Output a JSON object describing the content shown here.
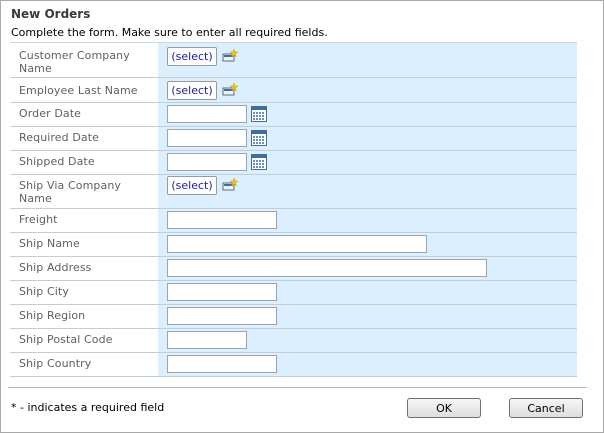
{
  "dialog": {
    "title": "New Orders",
    "description": "Complete the form. Make sure to enter all required fields."
  },
  "fields": {
    "customer_company": {
      "label": "Customer Company Name",
      "button": "(select)"
    },
    "employee_last": {
      "label": "Employee Last Name",
      "button": "(select)"
    },
    "order_date": {
      "label": "Order Date",
      "value": ""
    },
    "required_date": {
      "label": "Required Date",
      "value": ""
    },
    "shipped_date": {
      "label": "Shipped Date",
      "value": ""
    },
    "ship_via": {
      "label": "Ship Via Company Name",
      "button": "(select)"
    },
    "freight": {
      "label": "Freight",
      "value": ""
    },
    "ship_name": {
      "label": "Ship Name",
      "value": ""
    },
    "ship_address": {
      "label": "Ship Address",
      "value": ""
    },
    "ship_city": {
      "label": "Ship City",
      "value": ""
    },
    "ship_region": {
      "label": "Ship Region",
      "value": ""
    },
    "ship_postal_code": {
      "label": "Ship Postal Code",
      "value": ""
    },
    "ship_country": {
      "label": "Ship Country",
      "value": ""
    }
  },
  "footer": {
    "note": "* - indicates a required field",
    "ok": "OK",
    "cancel": "Cancel"
  },
  "icons": {
    "new": "new-item-icon",
    "calendar": "calendar-icon"
  },
  "colors": {
    "form_bg": "#dcefff",
    "row_border": "#c4cdd6",
    "select_text": "#1b1b99"
  }
}
